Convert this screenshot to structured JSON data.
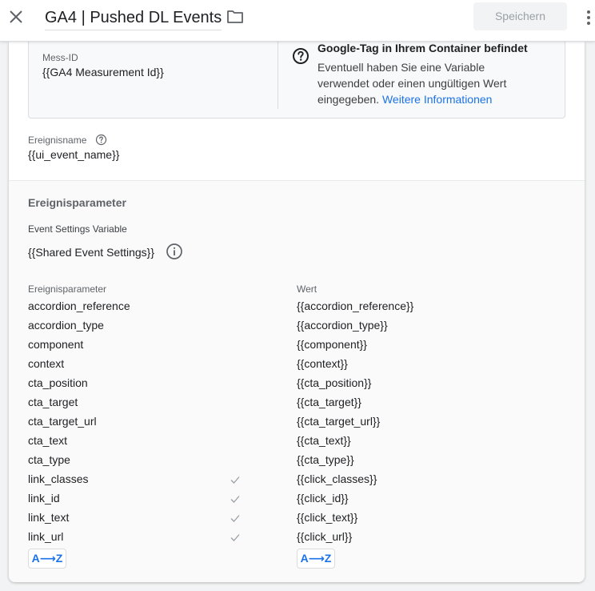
{
  "header": {
    "title": "GA4 | Pushed DL Events",
    "save_label": "Speichern"
  },
  "config": {
    "measurement_label": "Mess-ID",
    "measurement_value": "{{GA4 Measurement Id}}",
    "warning_title": "Google-Tag in Ihrem Container befindet",
    "warning_text": "Eventuell haben Sie eine Variable verwendet oder einen ungültigen Wert eingegeben.",
    "warning_link": "Weitere Informationen"
  },
  "event": {
    "name_label": "Ereignisname",
    "name_value": "{{ui_event_name}}"
  },
  "params_section": {
    "heading": "Ereignisparameter",
    "settings_label": "Event Settings Variable",
    "settings_value": "{{Shared Event Settings}}",
    "col_param": "Ereignisparameter",
    "col_value": "Wert",
    "sort_label": "A⟶Z",
    "rows": [
      {
        "param": "accordion_reference",
        "value": "{{accordion_reference}}",
        "check": false
      },
      {
        "param": "accordion_type",
        "value": "{{accordion_type}}",
        "check": false
      },
      {
        "param": "component",
        "value": "{{component}}",
        "check": false
      },
      {
        "param": "context",
        "value": "{{context}}",
        "check": false
      },
      {
        "param": "cta_position",
        "value": "{{cta_position}}",
        "check": false
      },
      {
        "param": "cta_target",
        "value": "{{cta_target}}",
        "check": false
      },
      {
        "param": "cta_target_url",
        "value": "{{cta_target_url}}",
        "check": false
      },
      {
        "param": "cta_text",
        "value": "{{cta_text}}",
        "check": false
      },
      {
        "param": "cta_type",
        "value": "{{cta_type}}",
        "check": false
      },
      {
        "param": "link_classes",
        "value": "{{click_classes}}",
        "check": true
      },
      {
        "param": "link_id",
        "value": "{{click_id}}",
        "check": true
      },
      {
        "param": "link_text",
        "value": "{{click_text}}",
        "check": true
      },
      {
        "param": "link_url",
        "value": "{{click_url}}",
        "check": true
      }
    ]
  },
  "icons": {
    "close": "close-icon",
    "folder": "folder-icon",
    "more": "more-vert-icon",
    "help": "help-circle-icon",
    "info": "info-icon",
    "check": "check-icon"
  },
  "colors": {
    "accent": "#1a73e8",
    "text": "#202124",
    "muted": "#5f6368",
    "check": "#9aa0a6"
  }
}
